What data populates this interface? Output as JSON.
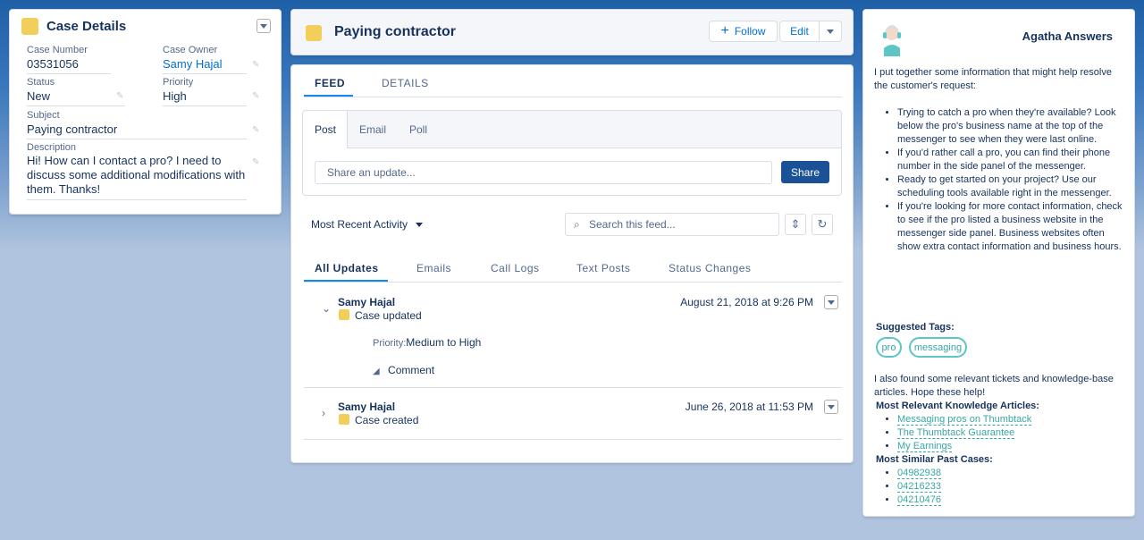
{
  "case_details": {
    "title": "Case Details",
    "fields": {
      "case_number": {
        "label": "Case Number",
        "value": "03531056"
      },
      "case_owner": {
        "label": "Case Owner",
        "value": "Samy Hajal"
      },
      "status": {
        "label": "Status",
        "value": "New"
      },
      "priority": {
        "label": "Priority",
        "value": "High"
      },
      "subject": {
        "label": "Subject",
        "value": "Paying contractor"
      },
      "description": {
        "label": "Description",
        "value": "Hi! How can I contact a pro? I need to discuss some additional modifications with them. Thanks!"
      }
    }
  },
  "header": {
    "title": "Paying contractor",
    "follow_label": "Follow",
    "edit_label": "Edit"
  },
  "feed": {
    "tabs": [
      "FEED",
      "DETAILS"
    ],
    "publisher": {
      "tabs": [
        "Post",
        "Email",
        "Poll"
      ],
      "placeholder": "Share an update...",
      "share_label": "Share"
    },
    "sort_label": "Most Recent Activity",
    "search_placeholder": "Search this feed...",
    "sub_tabs": [
      "All Updates",
      "Emails",
      "Call Logs",
      "Text Posts",
      "Status Changes"
    ],
    "items": [
      {
        "author": "Samy Hajal",
        "action": "Case updated",
        "date": "August 21, 2018 at 9:26 PM",
        "change_label": "Priority:",
        "change_value": "Medium to High",
        "comment_label": "Comment"
      },
      {
        "author": "Samy Hajal",
        "action": "Case created",
        "date": "June 26, 2018 at 11:53 PM"
      }
    ]
  },
  "agatha": {
    "title": "Agatha Answers",
    "intro": "I put together some information that might help resolve the customer's request:",
    "tips": [
      "Trying to catch a pro when they're available? Look below the pro's business name at the top of the messenger to see when they were last online.",
      "If you'd rather call a pro, you can find their phone number in the side panel of the messenger.",
      "Ready to get started on your project? Use our scheduling tools available right in the messenger.",
      "If you're looking for more contact information, check to see if the pro listed a business website in the messenger side panel. Business websites often show extra contact information and business hours."
    ],
    "suggested_tags_label": "Suggested Tags:",
    "tags": [
      "pro",
      "messaging"
    ],
    "found_text": "I also found some relevant tickets and knowledge-base articles. Hope these help!",
    "articles_label": "Most Relevant Knowledge Articles:",
    "articles": [
      "Messaging pros on Thumbtack",
      "The Thumbtack Guarantee",
      "My Earnings"
    ],
    "cases_label": "Most Similar Past Cases:",
    "cases": [
      "04982938",
      "04216233",
      "04210476"
    ]
  }
}
